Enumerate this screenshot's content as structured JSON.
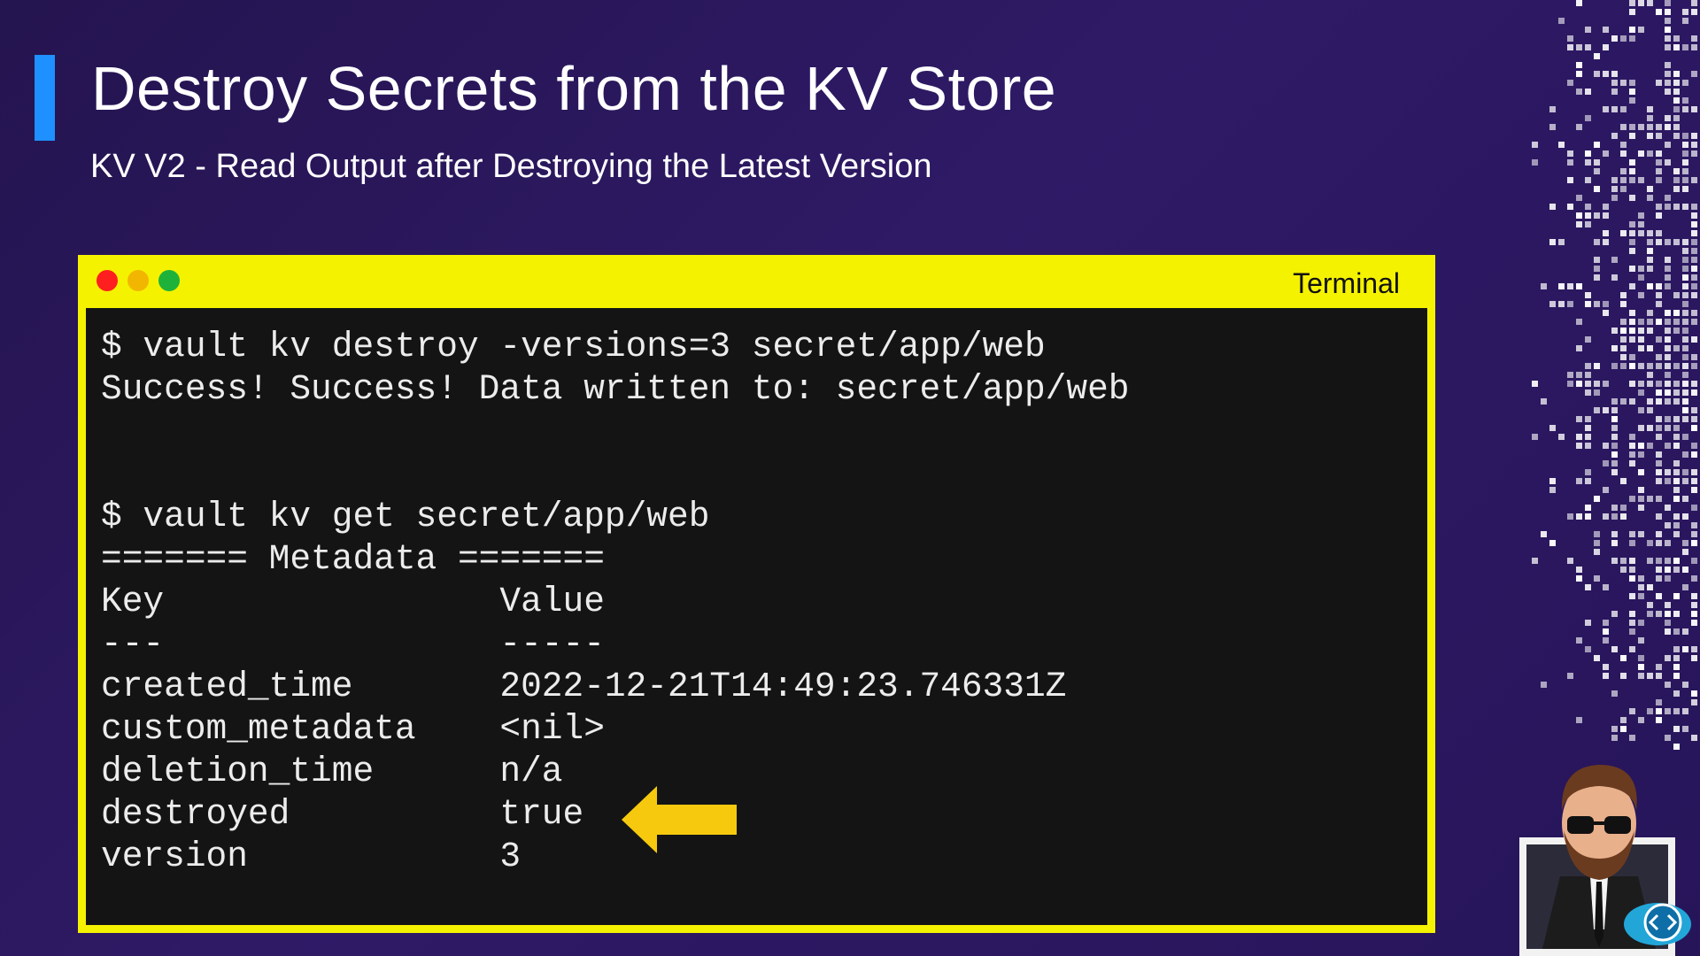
{
  "slide": {
    "title": "Destroy Secrets from the KV Store",
    "subtitle": "KV V2 - Read Output after Destroying the Latest Version"
  },
  "terminal": {
    "title": "Terminal",
    "lines": [
      "$ vault kv destroy -versions=3 secret/app/web",
      "Success! Success! Data written to: secret/app/web",
      "",
      "",
      "$ vault kv get secret/app/web",
      "======= Metadata =======",
      "Key                Value",
      "---                -----",
      "created_time       2022-12-21T14:49:23.746331Z",
      "custom_metadata    <nil>",
      "deletion_time      n/a",
      "destroyed          true",
      "version            3"
    ]
  },
  "colors": {
    "background": "#2a175d",
    "accent": "#1e90ff",
    "terminal_frame": "#f5f200",
    "terminal_bg": "#141414",
    "arrow": "#f6c90e",
    "window_close": "#ff1f1f",
    "window_minimize": "#f2b600",
    "window_maximize": "#1fb23a"
  },
  "icons": {
    "arrow": "arrow-left-icon",
    "window_controls": [
      "close-dot-icon",
      "minimize-dot-icon",
      "maximize-dot-icon"
    ],
    "presenter": "presenter-avatar-icon",
    "logo": "cloud-code-logo-icon"
  }
}
